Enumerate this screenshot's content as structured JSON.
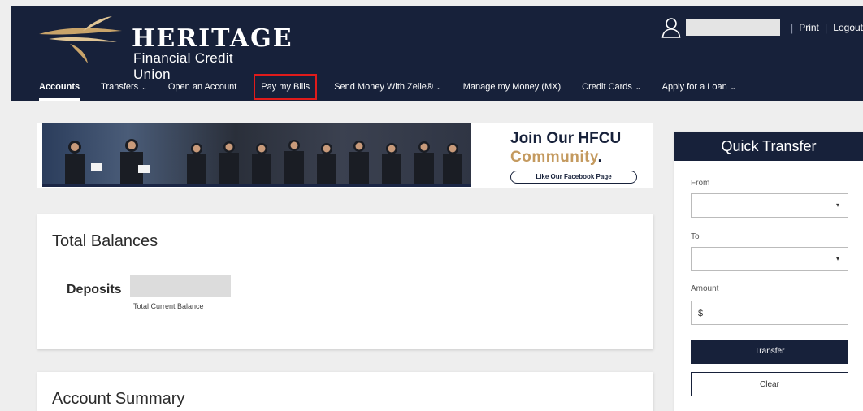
{
  "brand": {
    "name": "HERITAGE",
    "subtitle": "Financial Credit Union"
  },
  "top_links": {
    "print": "Print",
    "logout": "Logout",
    "separator": "|"
  },
  "nav": {
    "items": [
      {
        "label": "Accounts",
        "active": true,
        "dropdown": false
      },
      {
        "label": "Transfers",
        "dropdown": true
      },
      {
        "label": "Open an Account",
        "dropdown": false
      },
      {
        "label": "Pay my Bills",
        "dropdown": false,
        "highlighted": true
      },
      {
        "label": "Send Money With Zelle®",
        "dropdown": true
      },
      {
        "label": "Manage my Money (MX)",
        "dropdown": false
      },
      {
        "label": "Credit Cards",
        "dropdown": true
      },
      {
        "label": "Apply for a Loan",
        "dropdown": true
      }
    ],
    "caret": "⌄"
  },
  "banner": {
    "title": "Join Our HFCU",
    "subtitle": "Community",
    "subtitle_dot": ".",
    "button": "Like Our Facebook Page"
  },
  "balances": {
    "title": "Total Balances",
    "deposits_label": "Deposits",
    "deposits_sub": "Total Current Balance"
  },
  "summary": {
    "title": "Account Summary"
  },
  "quick_transfer": {
    "title": "Quick Transfer",
    "from_label": "From",
    "to_label": "To",
    "amount_label": "Amount",
    "amount_value": "$",
    "transfer_button": "Transfer",
    "clear_button": "Clear"
  },
  "colors": {
    "navy": "#17213a",
    "gold": "#c49a5f",
    "highlight": "#e01b1b"
  }
}
